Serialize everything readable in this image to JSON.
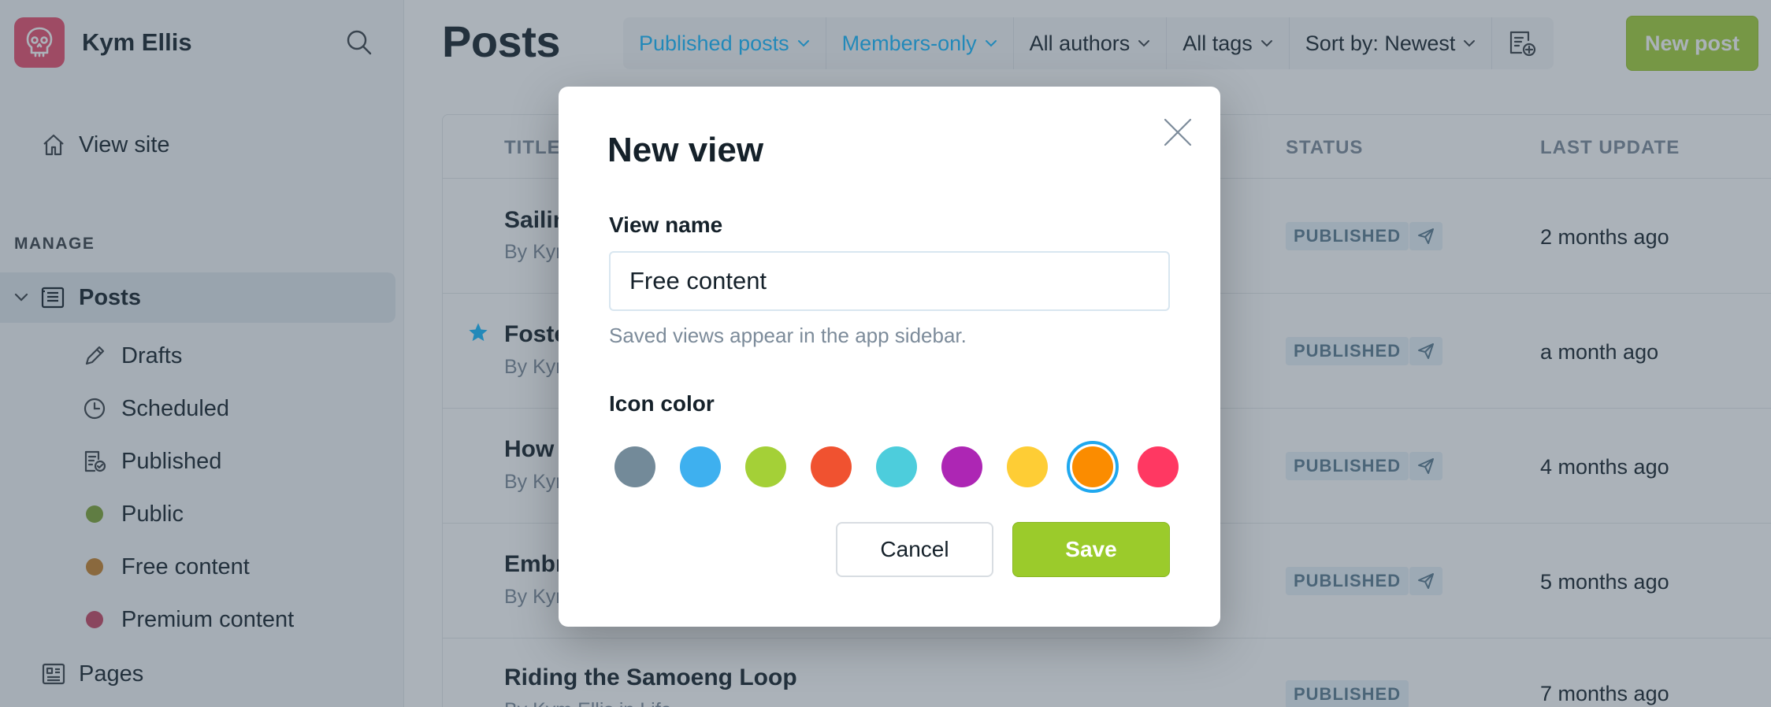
{
  "sidebar": {
    "user_name": "Kym Ellis",
    "view_site": "View site",
    "section_manage": "MANAGE",
    "posts": "Posts",
    "sub_items": [
      {
        "label": "Drafts"
      },
      {
        "label": "Scheduled"
      },
      {
        "label": "Published"
      },
      {
        "label": "Public",
        "color": "#7fa434"
      },
      {
        "label": "Free content",
        "color": "#c7812b"
      },
      {
        "label": "Premium content",
        "color": "#c74663"
      }
    ],
    "pages": "Pages"
  },
  "header": {
    "title": "Posts",
    "filters": [
      "Published posts",
      "Members-only",
      "All authors",
      "All tags",
      "Sort by: Newest"
    ],
    "new_post": "New post"
  },
  "table": {
    "columns": [
      "TITLE",
      "STATUS",
      "LAST UPDATE"
    ],
    "rows": [
      {
        "title": "Sailing",
        "byline": "By Kym",
        "status": "PUBLISHED",
        "updated": "2 months ago",
        "featured": false
      },
      {
        "title": "Fostering",
        "byline": "By Kym",
        "status": "PUBLISHED",
        "updated": "a month ago",
        "featured": true
      },
      {
        "title": "How",
        "byline": "By Kym",
        "status": "PUBLISHED",
        "updated": "4 months ago",
        "featured": false
      },
      {
        "title": "Embracing",
        "byline": "By Kym",
        "status": "PUBLISHED",
        "updated": "5 months ago",
        "featured": false
      },
      {
        "title": "Riding the Samoeng Loop",
        "byline": "By Kym Ellis in Life",
        "status": "PUBLISHED",
        "updated": "7 months ago",
        "featured": false
      }
    ]
  },
  "modal": {
    "title": "New view",
    "name_label": "View name",
    "name_value": "Free content",
    "hint": "Saved views appear in the app sidebar.",
    "color_label": "Icon color",
    "colors": [
      "#738a99",
      "#3eb0ef",
      "#a4d037",
      "#f05230",
      "#4dcddc",
      "#ad26b4",
      "#fecd35",
      "#fb8c00",
      "#ff3862"
    ],
    "selected_color_index": 7,
    "cancel": "Cancel",
    "save": "Save"
  },
  "colors": {
    "accent": "#14b8ff",
    "brand_green": "#a4d037",
    "brand_logo": "#e94f6d"
  }
}
